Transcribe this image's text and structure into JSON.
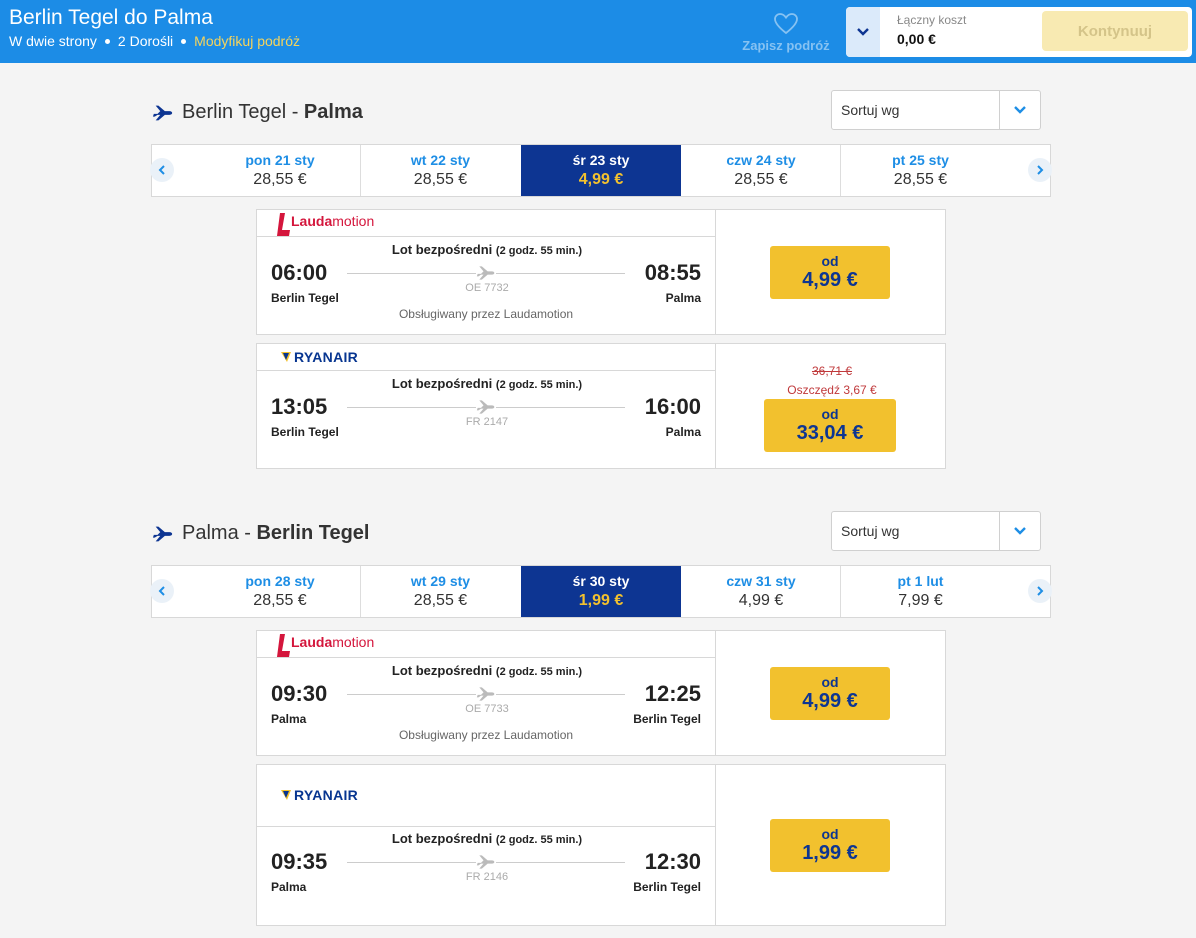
{
  "header": {
    "title": "Berlin Tegel do Palma",
    "trip_type": "W dwie strony",
    "passengers": "2 Dorośli",
    "modify_link": "Modyfikuj podróż",
    "save_trip": "Zapisz podróż",
    "total_cost_label": "Łączny koszt",
    "total_cost_value": "0,00 €",
    "continue_label": "Kontynuuj"
  },
  "sections": [
    {
      "origin": "Berlin Tegel",
      "separator": " - ",
      "destination": "Palma",
      "sort_label": "Sortuj wg",
      "dates": [
        {
          "day": "pon 21 sty",
          "price": "28,55 €"
        },
        {
          "day": "wt 22 sty",
          "price": "28,55 €"
        },
        {
          "day": "śr 23 sty",
          "price": "4,99 €"
        },
        {
          "day": "czw 24 sty",
          "price": "28,55 €"
        },
        {
          "day": "pt 25 sty",
          "price": "28,55 €"
        }
      ],
      "flights": [
        {
          "airline_bold": "Lauda",
          "airline_rest": "motion",
          "direct_label": "Lot bezpośredni",
          "duration": "(2 godz. 55 min.)",
          "dep_time": "06:00",
          "dep_city": "Berlin Tegel",
          "arr_time": "08:55",
          "arr_city": "Palma",
          "flight_no": "OE 7732",
          "operated_by": "Obsługiwany przez Laudamotion",
          "from_label": "od",
          "price": "4,99 €"
        },
        {
          "airline": "RYANAIR",
          "direct_label": "Lot bezpośredni",
          "duration": "(2 godz. 55 min.)",
          "dep_time": "13:05",
          "dep_city": "Berlin Tegel",
          "arr_time": "16:00",
          "arr_city": "Palma",
          "flight_no": "FR 2147",
          "old_price": "36,71 €",
          "savings": "Oszczędź  3,67 €",
          "from_label": "od",
          "price": "33,04 €"
        }
      ]
    },
    {
      "origin": "Palma",
      "separator": " - ",
      "destination": "Berlin Tegel",
      "sort_label": "Sortuj wg",
      "dates": [
        {
          "day": "pon 28 sty",
          "price": "28,55 €"
        },
        {
          "day": "wt 29 sty",
          "price": "28,55 €"
        },
        {
          "day": "śr 30 sty",
          "price": "1,99 €"
        },
        {
          "day": "czw 31 sty",
          "price": "4,99 €"
        },
        {
          "day": "pt 1 lut",
          "price": "7,99 €"
        }
      ],
      "flights": [
        {
          "airline_bold": "Lauda",
          "airline_rest": "motion",
          "direct_label": "Lot bezpośredni",
          "duration": "(2 godz. 55 min.)",
          "dep_time": "09:30",
          "dep_city": "Palma",
          "arr_time": "12:25",
          "arr_city": "Berlin Tegel",
          "flight_no": "OE 7733",
          "operated_by": "Obsługiwany przez Laudamotion",
          "from_label": "od",
          "price": "4,99 €"
        },
        {
          "airline": "RYANAIR",
          "direct_label": "Lot bezpośredni",
          "duration": "(2 godz. 55 min.)",
          "dep_time": "09:35",
          "dep_city": "Palma",
          "arr_time": "12:30",
          "arr_city": "Berlin Tegel",
          "flight_no": "FR 2146",
          "from_label": "od",
          "price": "1,99 €"
        }
      ]
    }
  ],
  "colors": {
    "header_blue": "#1c8ce6",
    "selected_date": "#0d3592",
    "price_yellow": "#f2c12e",
    "lauda_red": "#d4163c",
    "ryanair_blue": "#073590"
  },
  "icons": [
    "heart-icon",
    "chevron-down-icon",
    "plane-icon",
    "chevron-left-icon",
    "chevron-right-icon",
    "ryanair-harp-icon"
  ]
}
